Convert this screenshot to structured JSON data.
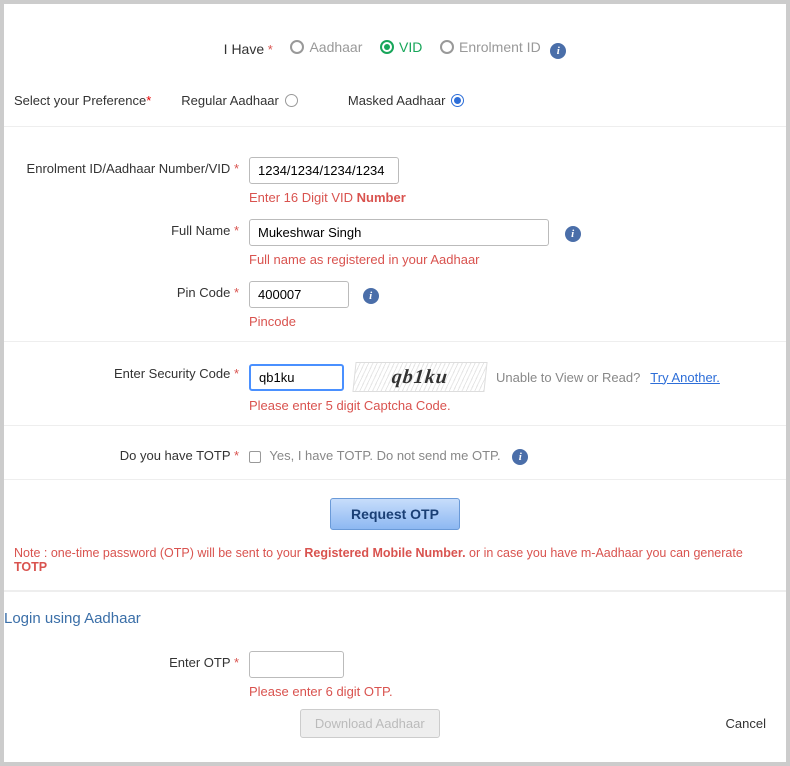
{
  "header": {
    "i_have_label": "I Have",
    "options": {
      "aadhaar": "Aadhaar",
      "vid": "VID",
      "enrolment": "Enrolment ID"
    }
  },
  "preference": {
    "label": "Select your Preference",
    "regular": "Regular Aadhaar",
    "masked": "Masked Aadhaar"
  },
  "fields": {
    "id": {
      "label": "Enrolment ID/Aadhaar Number/VID",
      "value": "1234/1234/1234/1234",
      "hint_prefix": "Enter 16 Digit VID ",
      "hint_bold": "Number"
    },
    "name": {
      "label": "Full Name",
      "value": "Mukeshwar Singh",
      "hint": "Full name as registered in your Aadhaar"
    },
    "pin": {
      "label": "Pin Code",
      "value": "400007",
      "hint": "Pincode"
    }
  },
  "security": {
    "label": "Enter Security Code",
    "value": "qb1ku",
    "captcha_text": "qb1ku",
    "unable": "Unable to View or Read?",
    "try": "Try Another.",
    "hint": "Please enter 5 digit Captcha Code."
  },
  "totp": {
    "label": "Do you have TOTP",
    "checkbox_label": "Yes, I have TOTP. Do not send me OTP."
  },
  "actions": {
    "request_otp": "Request OTP",
    "note_prefix": "Note : one-time password (OTP) will be sent to your ",
    "note_bold1": "Registered Mobile Number.",
    "note_mid": " or in case you have m-Aadhaar you can generate ",
    "note_bold2": "TOTP"
  },
  "login": {
    "title": "Login using Aadhaar",
    "otp_label": "Enter OTP",
    "otp_value": "",
    "otp_hint": "Please enter 6 digit OTP.",
    "download": "Download Aadhaar",
    "cancel": "Cancel"
  }
}
